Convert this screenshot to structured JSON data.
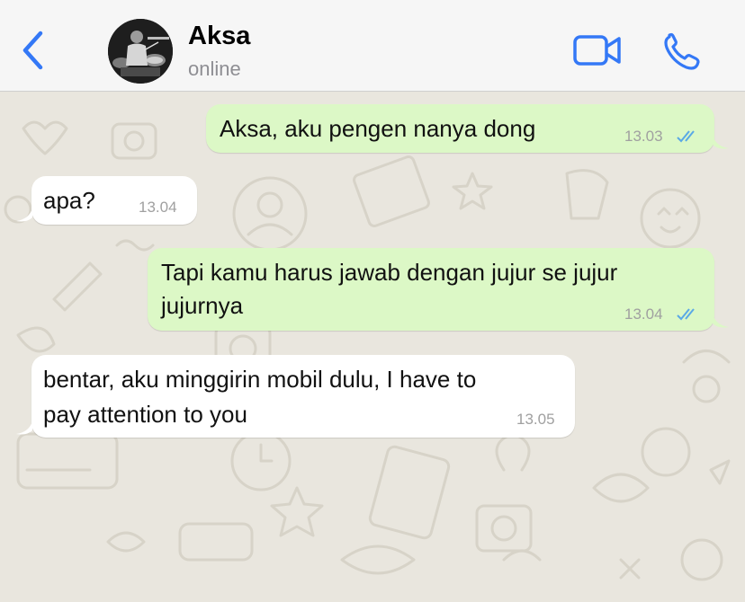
{
  "header": {
    "back_icon": "chevron-left-icon",
    "contact_name": "Aksa",
    "contact_status": "online",
    "video_icon": "video-camera-icon",
    "call_icon": "phone-icon",
    "accent_color": "#3478f6"
  },
  "messages": [
    {
      "direction": "outgoing",
      "text": "Aksa, aku pengen nanya dong",
      "time": "13.03",
      "status": "read"
    },
    {
      "direction": "incoming",
      "text": "apa?",
      "time": "13.04"
    },
    {
      "direction": "outgoing",
      "text_line1": "Tapi kamu harus jawab dengan jujur se jujur",
      "text_line2": "jujurnya",
      "time": "13.04",
      "status": "read"
    },
    {
      "direction": "incoming",
      "text_line1": "bentar, aku minggirin mobil dulu, I have to",
      "text_line2": "pay attention to you",
      "time": "13.05"
    }
  ],
  "colors": {
    "outgoing_bubble": "#dcf8c6",
    "incoming_bubble": "#ffffff",
    "read_ticks": "#5aa9e6",
    "chat_background": "#e9e6de"
  }
}
